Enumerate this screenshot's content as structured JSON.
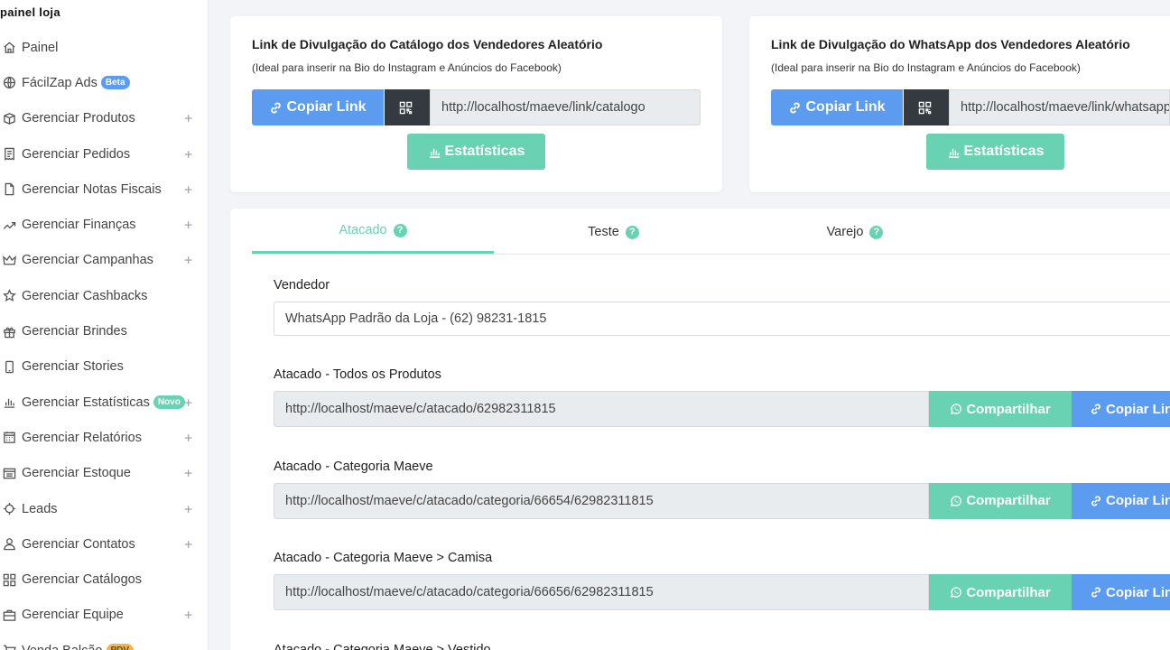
{
  "sidebar": {
    "title": "painel loja",
    "items": [
      {
        "label": "Painel",
        "icon": "home-icon",
        "plus": false
      },
      {
        "label": "FácilZap Ads",
        "icon": "globe-icon",
        "plus": false,
        "badge": "Beta",
        "badge_color": "blue"
      },
      {
        "label": "Gerenciar Produtos",
        "icon": "box-icon",
        "plus": true
      },
      {
        "label": "Gerenciar Pedidos",
        "icon": "receipt-icon",
        "plus": true
      },
      {
        "label": "Gerenciar Notas Fiscais",
        "icon": "file-icon",
        "plus": true
      },
      {
        "label": "Gerenciar Finanças",
        "icon": "trend-icon",
        "plus": true
      },
      {
        "label": "Gerenciar Campanhas",
        "icon": "crown-icon",
        "plus": true
      },
      {
        "label": "Gerenciar Cashbacks",
        "icon": "star-icon",
        "plus": false
      },
      {
        "label": "Gerenciar Brindes",
        "icon": "gift-icon",
        "plus": false
      },
      {
        "label": "Gerenciar Stories",
        "icon": "phone-icon",
        "plus": false
      },
      {
        "label": "Gerenciar Estatísticas",
        "icon": "bar-chart-icon",
        "plus": true,
        "badge": "Novo",
        "badge_color": "green"
      },
      {
        "label": "Gerenciar Relatórios",
        "icon": "calendar-icon",
        "plus": true
      },
      {
        "label": "Gerenciar Estoque",
        "icon": "inbox-icon",
        "plus": true
      },
      {
        "label": "Leads",
        "icon": "target-icon",
        "plus": true
      },
      {
        "label": "Gerenciar Contatos",
        "icon": "user-icon",
        "plus": true
      },
      {
        "label": "Gerenciar Catálogos",
        "icon": "grid-icon",
        "plus": false
      },
      {
        "label": "Gerenciar Equipe",
        "icon": "briefcase-icon",
        "plus": true
      },
      {
        "label": "Venda Balcão",
        "icon": "cart-icon",
        "plus": false,
        "badge": "PDV",
        "badge_color": "orange"
      }
    ]
  },
  "catalog_card": {
    "title": "Link de Divulgação do Catálogo dos Vendedores Aleatório",
    "subtitle": "(Ideal para inserir na Bio do Instagram e Anúncios do Facebook)",
    "copy_label": "Copiar Link",
    "url": "http://localhost/maeve/link/catalogo",
    "stats_label": "Estatísticas"
  },
  "whatsapp_card": {
    "title": "Link de Divulgação do WhatsApp dos Vendedores Aleatório",
    "subtitle": "(Ideal para inserir na Bio do Instagram e Anúncios do Facebook)",
    "copy_label": "Copiar Link",
    "url": "http://localhost/maeve/link/whatsapp",
    "stats_label": "Estatísticas"
  },
  "tabs": [
    {
      "label": "Atacado",
      "active": true
    },
    {
      "label": "Teste",
      "active": false
    },
    {
      "label": "Varejo",
      "active": false
    }
  ],
  "vendedor": {
    "label": "Vendedor",
    "value": "WhatsApp Padrão da Loja - (62) 98231-1815"
  },
  "links": [
    {
      "label": "Atacado - Todos os Produtos",
      "url": "http://localhost/maeve/c/atacado/62982311815"
    },
    {
      "label": "Atacado - Categoria Maeve",
      "url": "http://localhost/maeve/c/atacado/categoria/66654/62982311815"
    },
    {
      "label": "Atacado - Categoria Maeve > Camisa",
      "url": "http://localhost/maeve/c/atacado/categoria/66656/62982311815"
    },
    {
      "label": "Atacado - Categoria Maeve > Vestido",
      "url": ""
    }
  ],
  "row_actions": {
    "share_label": "Compartilhar",
    "copy_label": "Copiar Link"
  },
  "colors": {
    "blue": "#5b9bf0",
    "green": "#68d2b3",
    "dark": "#343a40"
  }
}
